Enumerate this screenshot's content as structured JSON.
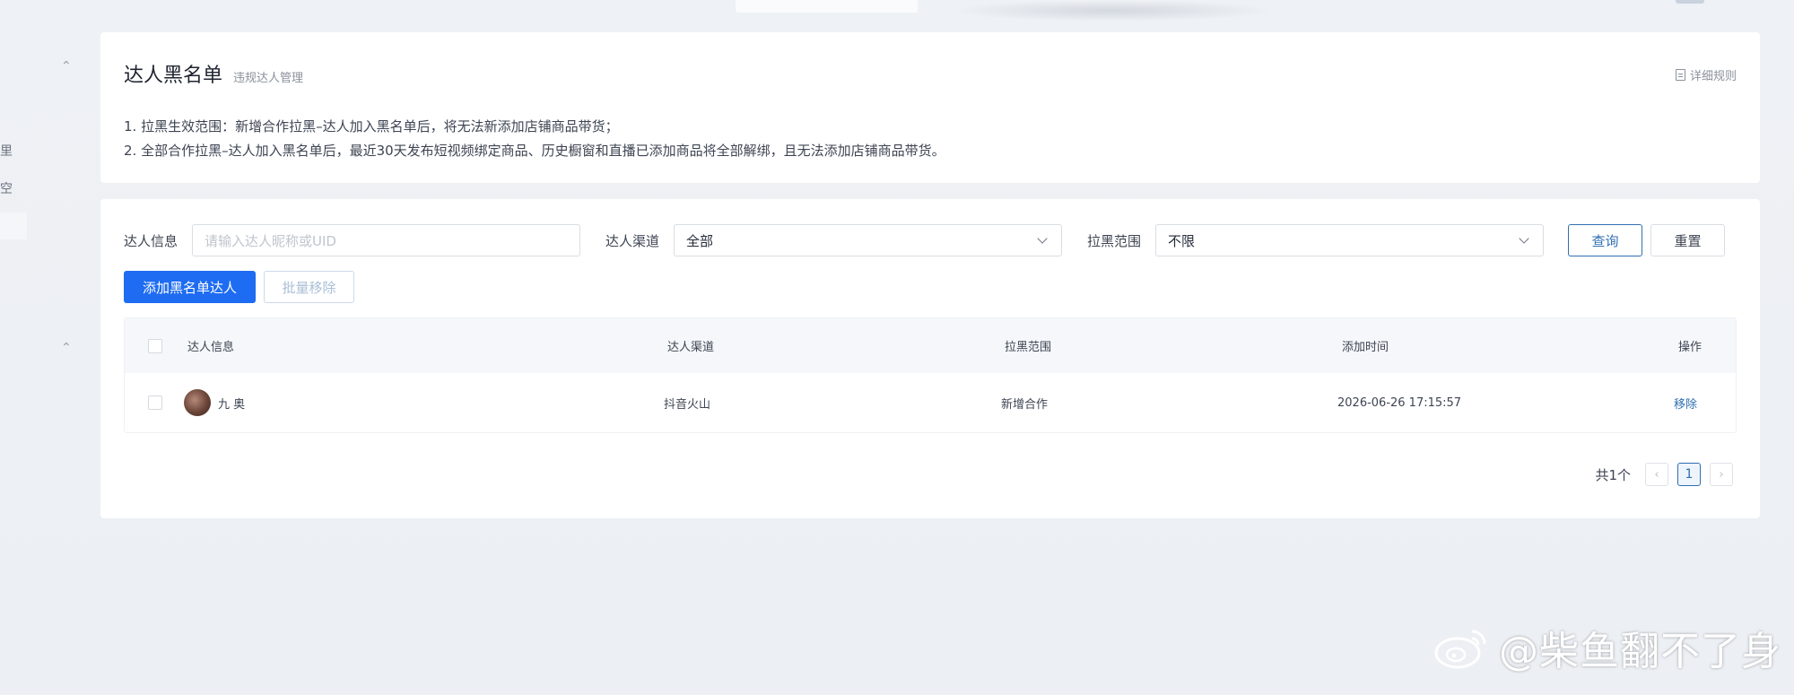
{
  "header": {
    "title": "达人黑名单",
    "subtitle": "违规达人管理",
    "rule_link": "详细规则"
  },
  "notes": [
    "1. 拉黑生效范围：新增合作拉黑–达人加入黑名单后，将无法新添加店铺商品带货；",
    "2. 全部合作拉黑–达人加入黑名单后，最近30天发布短视频绑定商品、历史橱窗和直播已添加商品将全部解绑，且无法添加店铺商品带货。"
  ],
  "sidebar": {
    "items": [
      "里",
      "空"
    ]
  },
  "filters": {
    "info_label": "达人信息",
    "info_placeholder": "请输入达人昵称或UID",
    "channel_label": "达人渠道",
    "channel_value": "全部",
    "scope_label": "拉黑范围",
    "scope_value": "不限",
    "query_label": "查询",
    "reset_label": "重置"
  },
  "actions": {
    "add_label": "添加黑名单达人",
    "batch_remove_label": "批量移除"
  },
  "table": {
    "columns": [
      "达人信息",
      "达人渠道",
      "拉黑范围",
      "添加时间",
      "操作"
    ],
    "rows": [
      {
        "name": "九  奥",
        "channel": "抖音火山",
        "scope": "新增合作",
        "time": "2026-06-26 17:15:57",
        "action": "移除"
      }
    ]
  },
  "pagination": {
    "total": "共1个",
    "prev": "‹",
    "current": "1",
    "next": "›"
  },
  "watermark": {
    "text": "@柴鱼翻不了身"
  },
  "colors": {
    "primary": "#1e6cf2",
    "link": "#2f6fb2",
    "background": "#eef1f5"
  }
}
